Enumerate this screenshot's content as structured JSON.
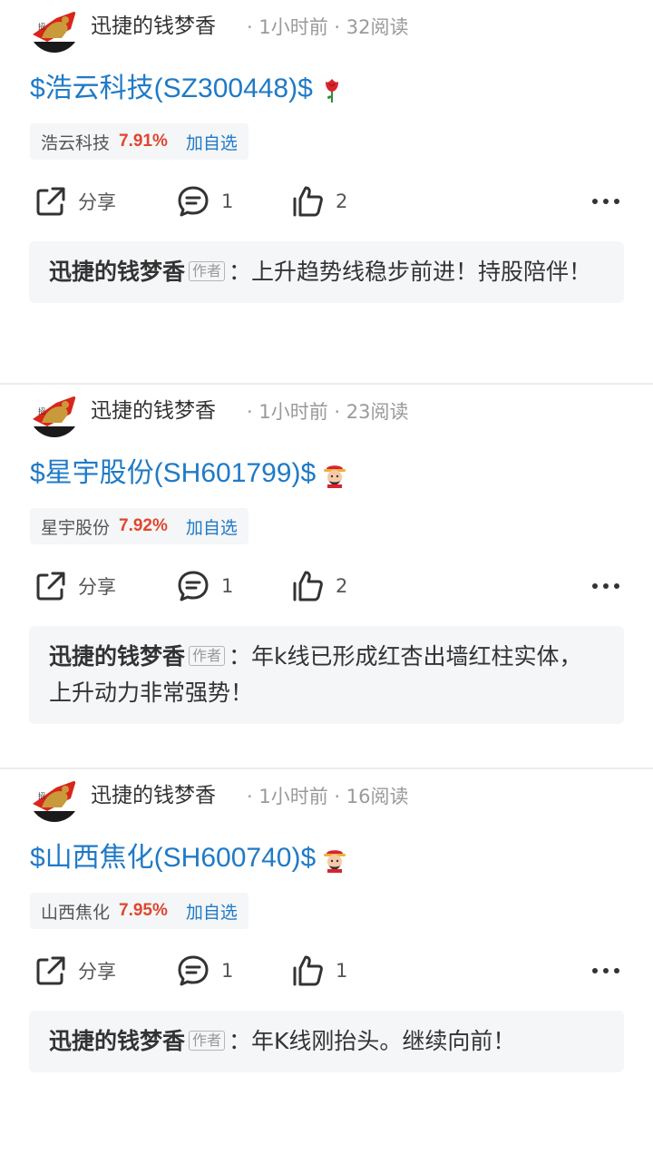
{
  "posts": [
    {
      "username": "迅捷的钱梦香",
      "meta": "· 1小时前 · 32阅读",
      "title": "$浩云科技(SZ300448)$",
      "title_emoji": "rose-icon",
      "stock": {
        "name": "浩云科技",
        "change": "7.91%",
        "add_label": "加自选"
      },
      "actions": {
        "share_label": "分享",
        "comment_count": "1",
        "like_count": "2"
      },
      "comment": {
        "author": "迅捷的钱梦香",
        "tag": "作者",
        "text": "：上升趋势线稳步前进！持股陪伴！"
      }
    },
    {
      "username": "迅捷的钱梦香",
      "meta": "· 1小时前 · 23阅读",
      "title": "$星宇股份(SH601799)$",
      "title_emoji": "god-of-wealth-icon",
      "stock": {
        "name": "星宇股份",
        "change": "7.92%",
        "add_label": "加自选"
      },
      "actions": {
        "share_label": "分享",
        "comment_count": "1",
        "like_count": "2"
      },
      "comment": {
        "author": "迅捷的钱梦香",
        "tag": "作者",
        "text": "：年k线已形成红杏出墙红柱实体，上升动力非常强势！"
      }
    },
    {
      "username": "迅捷的钱梦香",
      "meta": "· 1小时前 · 16阅读",
      "title": "$山西焦化(SH600740)$",
      "title_emoji": "god-of-wealth-icon",
      "stock": {
        "name": "山西焦化",
        "change": "7.95%",
        "add_label": "加自选"
      },
      "actions": {
        "share_label": "分享",
        "comment_count": "1",
        "like_count": "1"
      },
      "comment": {
        "author": "迅捷的钱梦香",
        "tag": "作者",
        "text": "：年K线刚抬头。继续向前！"
      }
    }
  ],
  "colors": {
    "link": "#1f7ac7",
    "gain": "#e0462e",
    "chip_bg": "#f5f6f8"
  }
}
